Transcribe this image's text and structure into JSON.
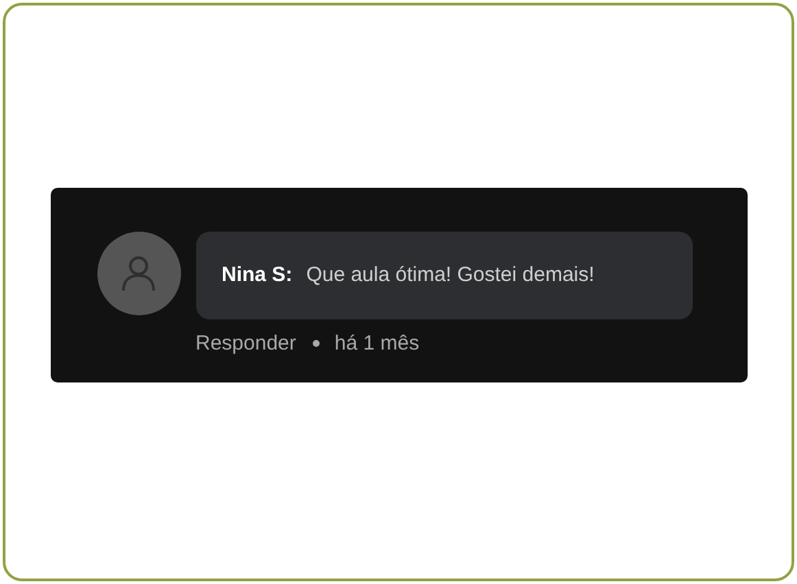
{
  "comment": {
    "author": "Nina S:",
    "text": "Que aula ótima! Gostei demais!",
    "reply_label": "Responder",
    "time": "há 1 mês"
  }
}
